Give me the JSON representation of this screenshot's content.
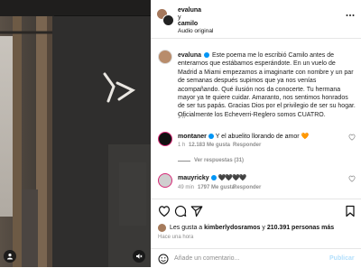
{
  "header": {
    "user1": "evaluna",
    "conj": "y",
    "user2": "camilo",
    "audio": "Audio original"
  },
  "caption": {
    "username": "evaluna",
    "text": "Este poema me lo escribió Camilo antes de enterarnos que estábamos esperándote. En un vuelo de Madrid a Miami empezamos a imaginarte con nombre y un par de semanas después supimos que ya nos venías acompañando. Qué ilusión nos da conocerte. Tu hermana mayor ya te quiere cuidar. Amaranto, nos sentimos honrados de ser tus papás. Gracias Dios por el privilegio de ser su hogar. Oficialmente los Echeverri-Reglero somos CUATRO.",
    "time": "1 h"
  },
  "comment1": {
    "username": "montaner",
    "text": "Y el abuelito llorando de amor 🧡",
    "time": "1 h",
    "likes": "12.183 Me gusta",
    "reply": "Responder",
    "view_replies": "Ver respuestas (31)"
  },
  "comment2": {
    "username": "mauyricky",
    "text": "🖤🖤🖤🖤",
    "time": "49 min",
    "likes": "1797 Me gusta",
    "reply": "Responder"
  },
  "likes_line": {
    "prefix": "Les gusta a",
    "user": "kimberlydosramos",
    "mid": "y",
    "count": "210.391 personas más"
  },
  "posted": "Hace una hora",
  "comment_input": {
    "placeholder": "Añade un comentario...",
    "publish": "Publicar"
  },
  "colors": {
    "accent": "#0095f6",
    "muted": "#8e8e8e"
  },
  "icons": [
    "more-icon",
    "verified-icon",
    "heart-icon",
    "comment-icon",
    "share-icon",
    "save-icon",
    "emoji-icon",
    "person-icon",
    "mute-icon"
  ]
}
